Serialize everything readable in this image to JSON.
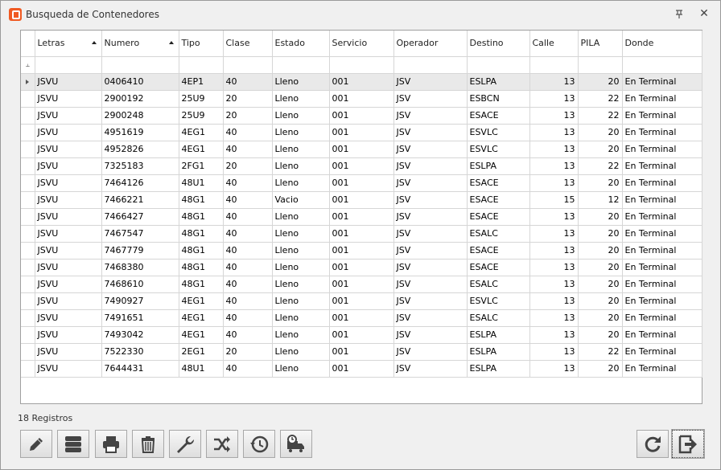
{
  "window": {
    "title": "Busqueda de Contenedores",
    "pin_icon": "pin-icon",
    "close_glyph": "✕"
  },
  "grid": {
    "columns": [
      {
        "key": "letras",
        "label": "Letras",
        "sorted": "asc"
      },
      {
        "key": "numero",
        "label": "Numero",
        "sorted": "asc"
      },
      {
        "key": "tipo",
        "label": "Tipo"
      },
      {
        "key": "clase",
        "label": "Clase"
      },
      {
        "key": "estado",
        "label": "Estado"
      },
      {
        "key": "servicio",
        "label": "Servicio"
      },
      {
        "key": "operador",
        "label": "Operador"
      },
      {
        "key": "destino",
        "label": "Destino"
      },
      {
        "key": "calle",
        "label": "Calle"
      },
      {
        "key": "pila",
        "label": "PILA"
      },
      {
        "key": "donde",
        "label": "Donde"
      }
    ],
    "filter_icon": "filter-icon",
    "selected_row": 0,
    "rows": [
      [
        "JSVU",
        "0406410",
        "4EP1",
        "40",
        "Lleno",
        "001",
        "JSV",
        "ESLPA",
        "13",
        "20",
        "En Terminal"
      ],
      [
        "JSVU",
        "2900192",
        "25U9",
        "20",
        "Lleno",
        "001",
        "JSV",
        "ESBCN",
        "13",
        "22",
        "En Terminal"
      ],
      [
        "JSVU",
        "2900248",
        "25U9",
        "20",
        "Lleno",
        "001",
        "JSV",
        "ESACE",
        "13",
        "22",
        "En Terminal"
      ],
      [
        "JSVU",
        "4951619",
        "4EG1",
        "40",
        "Lleno",
        "001",
        "JSV",
        "ESVLC",
        "13",
        "20",
        "En Terminal"
      ],
      [
        "JSVU",
        "4952826",
        "4EG1",
        "40",
        "Lleno",
        "001",
        "JSV",
        "ESVLC",
        "13",
        "20",
        "En Terminal"
      ],
      [
        "JSVU",
        "7325183",
        "2FG1",
        "20",
        "Lleno",
        "001",
        "JSV",
        "ESLPA",
        "13",
        "22",
        "En Terminal"
      ],
      [
        "JSVU",
        "7464126",
        "48U1",
        "40",
        "Lleno",
        "001",
        "JSV",
        "ESACE",
        "13",
        "20",
        "En Terminal"
      ],
      [
        "JSVU",
        "7466221",
        "48G1",
        "40",
        "Vacio",
        "001",
        "JSV",
        "ESACE",
        "15",
        "12",
        "En Terminal"
      ],
      [
        "JSVU",
        "7466427",
        "48G1",
        "40",
        "Lleno",
        "001",
        "JSV",
        "ESACE",
        "13",
        "20",
        "En Terminal"
      ],
      [
        "JSVU",
        "7467547",
        "48G1",
        "40",
        "Lleno",
        "001",
        "JSV",
        "ESALC",
        "13",
        "20",
        "En Terminal"
      ],
      [
        "JSVU",
        "7467779",
        "48G1",
        "40",
        "Lleno",
        "001",
        "JSV",
        "ESACE",
        "13",
        "20",
        "En Terminal"
      ],
      [
        "JSVU",
        "7468380",
        "48G1",
        "40",
        "Lleno",
        "001",
        "JSV",
        "ESACE",
        "13",
        "20",
        "En Terminal"
      ],
      [
        "JSVU",
        "7468610",
        "48G1",
        "40",
        "Lleno",
        "001",
        "JSV",
        "ESALC",
        "13",
        "20",
        "En Terminal"
      ],
      [
        "JSVU",
        "7490927",
        "4EG1",
        "40",
        "Lleno",
        "001",
        "JSV",
        "ESVLC",
        "13",
        "20",
        "En Terminal"
      ],
      [
        "JSVU",
        "7491651",
        "4EG1",
        "40",
        "Lleno",
        "001",
        "JSV",
        "ESALC",
        "13",
        "20",
        "En Terminal"
      ],
      [
        "JSVU",
        "7493042",
        "4EG1",
        "40",
        "Lleno",
        "001",
        "JSV",
        "ESLPA",
        "13",
        "20",
        "En Terminal"
      ],
      [
        "JSVU",
        "7522330",
        "2EG1",
        "20",
        "Lleno",
        "001",
        "JSV",
        "ESLPA",
        "13",
        "22",
        "En Terminal"
      ],
      [
        "JSVU",
        "7644431",
        "48U1",
        "40",
        "Lleno",
        "001",
        "JSV",
        "ESLPA",
        "13",
        "20",
        "En Terminal"
      ]
    ]
  },
  "status": {
    "record_count": "18 Registros"
  },
  "toolbar": {
    "left_buttons": [
      {
        "name": "edit-button",
        "icon": "pencil-icon"
      },
      {
        "name": "storage-button",
        "icon": "server-stack-icon"
      },
      {
        "name": "print-button",
        "icon": "printer-icon"
      },
      {
        "name": "delete-button",
        "icon": "trash-icon"
      },
      {
        "name": "settings-button",
        "icon": "wrench-icon"
      },
      {
        "name": "shuffle-button",
        "icon": "shuffle-icon"
      },
      {
        "name": "history-button",
        "icon": "clock-history-icon"
      },
      {
        "name": "delivery-button",
        "icon": "truck-clock-icon"
      }
    ],
    "right_buttons": [
      {
        "name": "refresh-button",
        "icon": "refresh-icon"
      },
      {
        "name": "exit-button",
        "icon": "exit-icon"
      }
    ]
  }
}
